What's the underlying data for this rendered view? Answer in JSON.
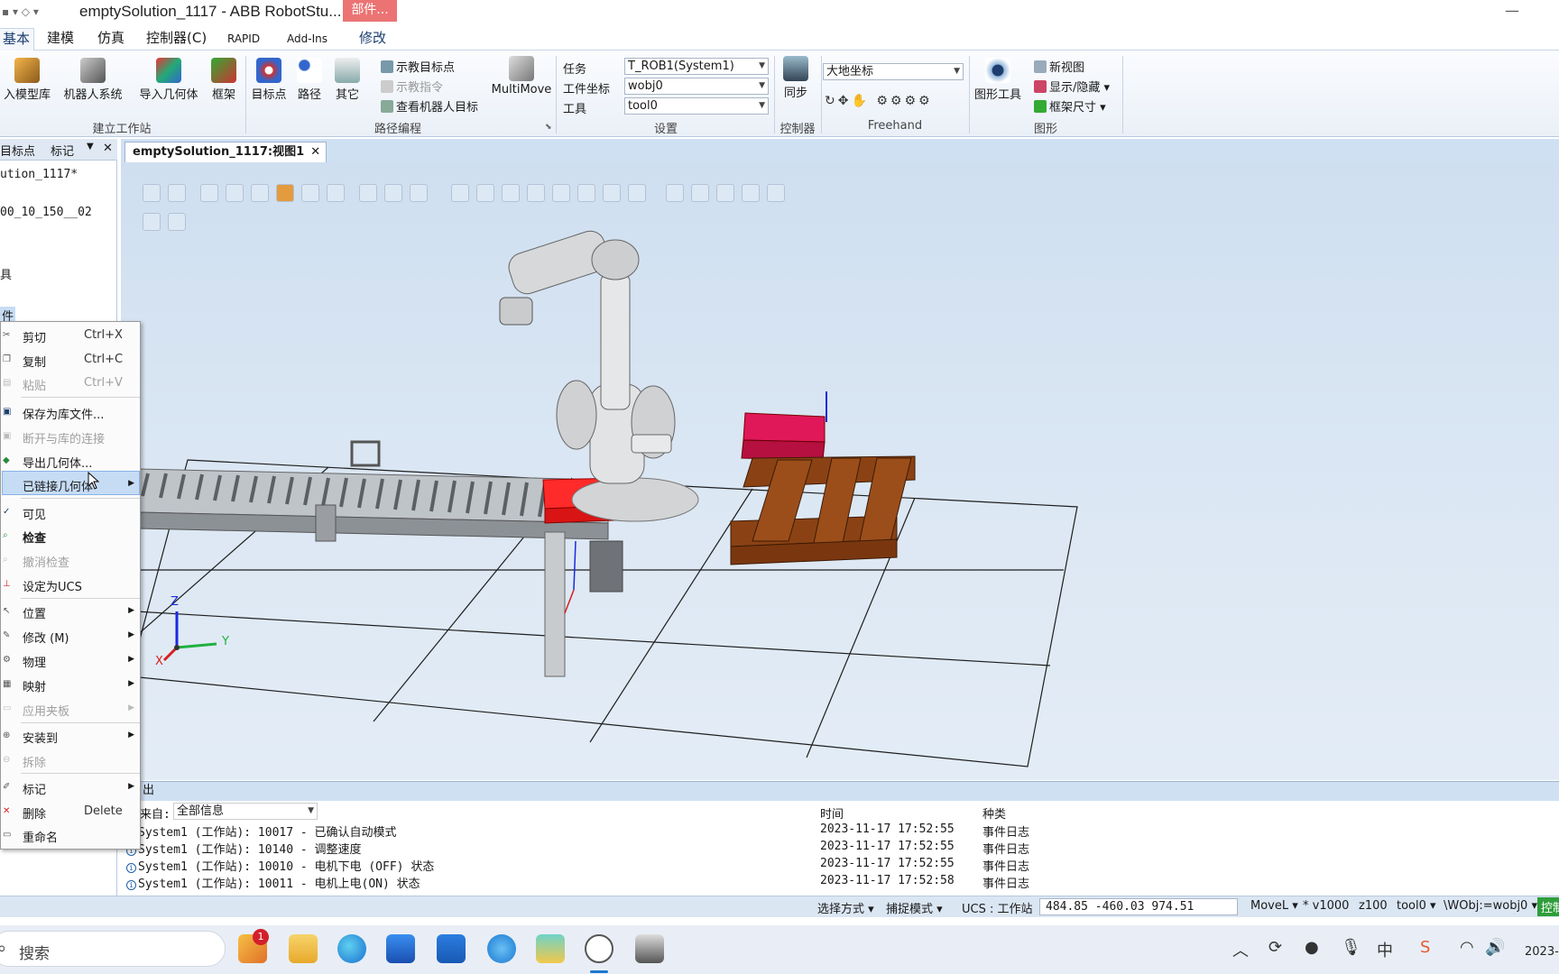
{
  "window": {
    "title": "emptySolution_1117 - ABB RobotStu...",
    "context_tab": "部件...",
    "minimize": "—"
  },
  "ribbon_tabs": [
    "基本",
    "建模",
    "仿真",
    "控制器(C)",
    "RAPID",
    "Add-Ins",
    "修改"
  ],
  "ribbon": {
    "build_station": {
      "label": "建立工作站",
      "buttons": [
        "入模型库",
        "机器人系统",
        "导入几何体",
        "框架"
      ]
    },
    "path_programming": {
      "label": "路径编程",
      "buttons": [
        "目标点",
        "路径",
        "其它"
      ],
      "small": [
        "示教目标点",
        "示教指令",
        "查看机器人目标"
      ],
      "multimove": "MultiMove"
    },
    "settings": {
      "label": "设置",
      "task_label": "任务",
      "task_value": "T_ROB1(System1)",
      "wobj_label": "工件坐标",
      "wobj_value": "wobj0",
      "tool_label": "工具",
      "tool_value": "tool0"
    },
    "controller": {
      "label": "控制器",
      "sync": "同步"
    },
    "freehand": {
      "label": "Freehand",
      "coord": "大地坐标"
    },
    "graphics": {
      "label": "图形",
      "tool": "图形工具",
      "small": [
        "新视图",
        "显示/隐藏",
        "框架尺寸"
      ]
    }
  },
  "left_panel": {
    "tabs": [
      "目标点",
      "标记"
    ],
    "tree": [
      "ution_1117*",
      "00_10_150__02",
      "具",
      "件"
    ]
  },
  "context_menu": {
    "items": [
      {
        "label": "剪切",
        "shortcut": "Ctrl+X",
        "disabled": false
      },
      {
        "label": "复制",
        "shortcut": "Ctrl+C",
        "disabled": false
      },
      {
        "label": "粘贴",
        "shortcut": "Ctrl+V",
        "disabled": true
      },
      {
        "label": "保存为库文件...",
        "disabled": false
      },
      {
        "label": "断开与库的连接",
        "disabled": true
      },
      {
        "label": "导出几何体...",
        "disabled": false
      },
      {
        "label": "已链接几何体",
        "disabled": false,
        "submenu": true,
        "highlighted": true
      },
      {
        "label": "可见",
        "disabled": false,
        "checked": true
      },
      {
        "label": "检查",
        "disabled": false,
        "bold": true
      },
      {
        "label": "撤消检查",
        "disabled": true
      },
      {
        "label": "设定为UCS",
        "disabled": false
      },
      {
        "label": "位置",
        "disabled": false,
        "submenu": true
      },
      {
        "label": "修改 (M)",
        "disabled": false,
        "submenu": true
      },
      {
        "label": "物理",
        "disabled": false,
        "submenu": true
      },
      {
        "label": "映射",
        "disabled": false,
        "submenu": true
      },
      {
        "label": "应用夹板",
        "disabled": true,
        "submenu": true
      },
      {
        "label": "安装到",
        "disabled": false,
        "submenu": true
      },
      {
        "label": "拆除",
        "disabled": true
      },
      {
        "label": "标记",
        "disabled": false,
        "submenu": true
      },
      {
        "label": "删除",
        "shortcut": "Delete",
        "disabled": false
      },
      {
        "label": "重命名",
        "disabled": false
      }
    ]
  },
  "viewport": {
    "doc_tab": "emptySolution_1117:视图1",
    "axis": {
      "x": "X",
      "y": "Y",
      "z": "Z"
    }
  },
  "output": {
    "header": "出",
    "filter_label": "息来自:",
    "filter_value": "全部信息",
    "col_time": "时间",
    "col_category": "种类",
    "rows": [
      {
        "msg": "System1 (工作站): 10017 - 已确认自动模式",
        "time": "2023-11-17 17:52:55",
        "category": "事件日志"
      },
      {
        "msg": "System1 (工作站): 10140 - 调整速度",
        "time": "2023-11-17 17:52:55",
        "category": "事件日志"
      },
      {
        "msg": "System1 (工作站): 10010 - 电机下电 (OFF) 状态",
        "time": "2023-11-17 17:52:55",
        "category": "事件日志"
      },
      {
        "msg": "System1 (工作站): 10011 - 电机上电(ON) 状态",
        "time": "2023-11-17 17:52:58",
        "category": "事件日志"
      }
    ]
  },
  "statusbar": {
    "select_mode": "选择方式",
    "snap_mode": "捕捉模式",
    "ucs": "UCS : 工作站",
    "coords": "484.85   -460.03   974.51",
    "move": "MoveL",
    "speed": "* v1000",
    "zone": "z100",
    "tool": "tool0",
    "wobj": "\\WObj:=wobj0",
    "ctrl": "控制"
  },
  "taskbar": {
    "search": "搜索",
    "badge": "1",
    "clock": "2023-",
    "ime_text": "中"
  },
  "colors": {
    "accent": "#1c3d6e",
    "red_box": "#e8141e",
    "pink_box": "#c4164a",
    "pallet": "#8a4214"
  }
}
